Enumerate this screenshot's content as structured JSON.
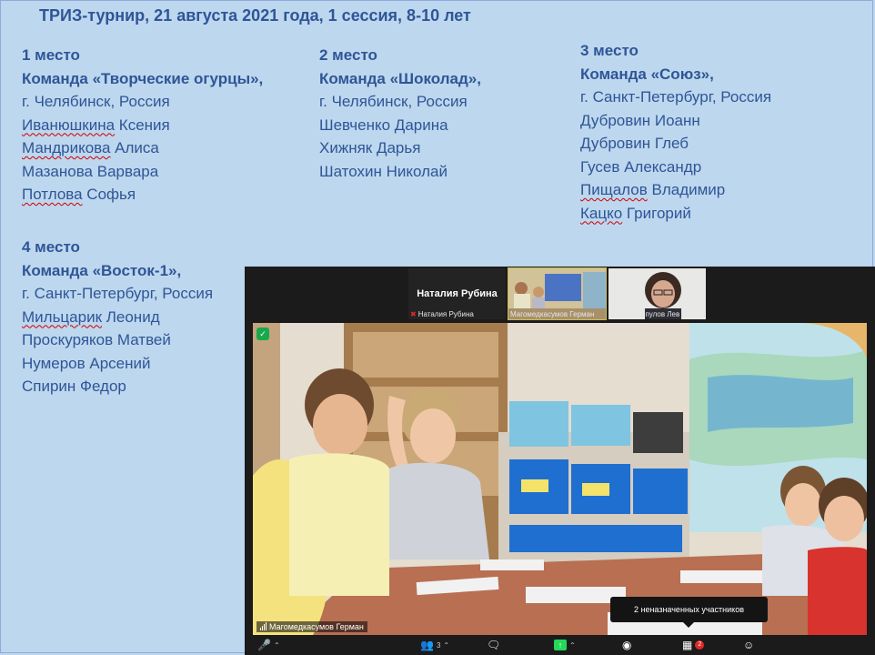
{
  "title": "ТРИЗ-турнир, 21 августа 2021 года, 1 сессия, 8-10 лет",
  "places": [
    {
      "place": "1 место",
      "team": "Команда «Творческие огурцы»,",
      "city": "г. Челябинск, Россия",
      "members": [
        {
          "spell": "Иванюшкина",
          "rest": " Ксения"
        },
        {
          "spell": "Мандрикова",
          "rest": " Алиса"
        },
        {
          "spell": "",
          "rest": "Мазанова Варвара"
        },
        {
          "spell": "Потлова",
          "rest": " Софья"
        }
      ]
    },
    {
      "place": "2 место",
      "team": "Команда «Шоколад»,",
      "city": "г. Челябинск, Россия",
      "members": [
        {
          "spell": "",
          "rest": "Шевченко Дарина"
        },
        {
          "spell": "",
          "rest": "Хижняк Дарья"
        },
        {
          "spell": "",
          "rest": "Шатохин Николай"
        }
      ]
    },
    {
      "place": "3 место",
      "team": "Команда «Союз»,",
      "city": "г. Санкт-Петербург, Россия",
      "members": [
        {
          "spell": "",
          "rest": "Дубровин Иоанн"
        },
        {
          "spell": "",
          "rest": "Дубровин Глеб"
        },
        {
          "spell": "",
          "rest": "Гусев Александр"
        },
        {
          "spell": "Пищалов",
          "rest": " Владимир"
        },
        {
          "spell": "Кацко",
          "rest": " Григорий"
        }
      ]
    },
    {
      "place": "4 место",
      "team": "Команда «Восток-1»,",
      "city": "г. Санкт-Петербург, Россия",
      "members": [
        {
          "spell": "Мильцарик",
          "rest": " Леонид"
        },
        {
          "spell": "",
          "rest": "Проскуряков Матвей"
        },
        {
          "spell": "",
          "rest": "Нумеров Арсений"
        },
        {
          "spell": "",
          "rest": "Спирин Федор"
        }
      ]
    }
  ],
  "zoom": {
    "thumbnails": [
      {
        "big_name": "Наталия Рубина",
        "label": "Наталия Рубина",
        "muted": true
      },
      {
        "big_name": "",
        "label": "Магомедкасумов Герман",
        "muted": false
      },
      {
        "big_name": "",
        "label": "Судья Карпулов Лев",
        "muted": false
      }
    ],
    "main_video_label": "Магомедкасумов Герман",
    "tooltip": "2 неназначенных участников",
    "toolbar": {
      "participants_count": "3",
      "breakout_badge": "2"
    },
    "colors": {
      "share_green": "#23d959",
      "mute_red": "#e02828",
      "shield_green": "#1aa84c",
      "slide_bg": "#bdd7ee",
      "text_blue": "#2f5597"
    }
  }
}
